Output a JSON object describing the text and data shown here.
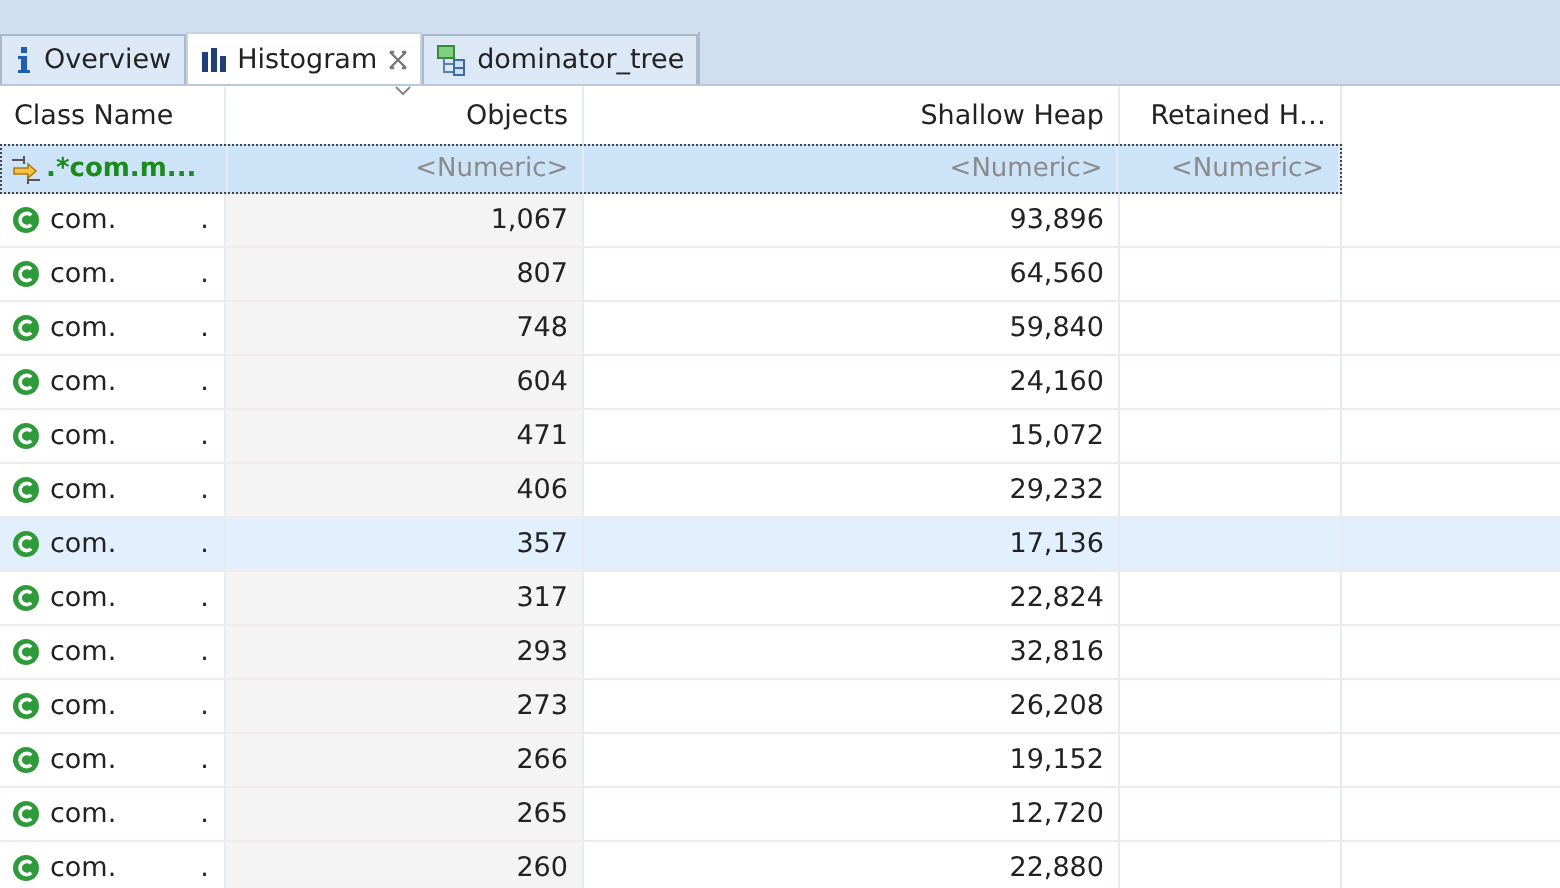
{
  "tabs": [
    {
      "label": "Overview",
      "kind": "info",
      "selected": false,
      "closable": false
    },
    {
      "label": "Histogram",
      "kind": "bars",
      "selected": true,
      "closable": true
    },
    {
      "label": "dominator_tree",
      "kind": "tree",
      "selected": false,
      "closable": false
    }
  ],
  "table": {
    "columns": [
      {
        "label": "Class Name",
        "sorted": false
      },
      {
        "label": "Objects",
        "sorted": true
      },
      {
        "label": "Shallow Heap",
        "sorted": false
      },
      {
        "label": "Retained H…",
        "sorted": false
      }
    ],
    "filter": {
      "pattern": ".*com.m...",
      "placeholders": [
        "<Numeric>",
        "<Numeric>",
        "<Numeric>"
      ]
    },
    "rows": [
      {
        "name": "com.",
        "tail": ".",
        "objects": "1,067",
        "shallow": "93,896",
        "selected": false
      },
      {
        "name": "com.",
        "tail": ".",
        "objects": "807",
        "shallow": "64,560",
        "selected": false
      },
      {
        "name": "com.",
        "tail": ".",
        "objects": "748",
        "shallow": "59,840",
        "selected": false
      },
      {
        "name": "com.",
        "tail": ".",
        "objects": "604",
        "shallow": "24,160",
        "selected": false
      },
      {
        "name": "com.",
        "tail": ".",
        "objects": "471",
        "shallow": "15,072",
        "selected": false
      },
      {
        "name": "com.",
        "tail": ".",
        "objects": "406",
        "shallow": "29,232",
        "selected": false
      },
      {
        "name": "com.",
        "tail": ".",
        "objects": "357",
        "shallow": "17,136",
        "selected": true
      },
      {
        "name": "com.",
        "tail": ".",
        "objects": "317",
        "shallow": "22,824",
        "selected": false
      },
      {
        "name": "com.",
        "tail": ".",
        "objects": "293",
        "shallow": "32,816",
        "selected": false
      },
      {
        "name": "com.",
        "tail": ".",
        "objects": "273",
        "shallow": "26,208",
        "selected": false
      },
      {
        "name": "com.",
        "tail": ".",
        "objects": "266",
        "shallow": "19,152",
        "selected": false
      },
      {
        "name": "com.",
        "tail": ".",
        "objects": "265",
        "shallow": "12,720",
        "selected": false
      },
      {
        "name": "com.",
        "tail": ".",
        "objects": "260",
        "shallow": "22,880",
        "selected": false
      }
    ]
  }
}
